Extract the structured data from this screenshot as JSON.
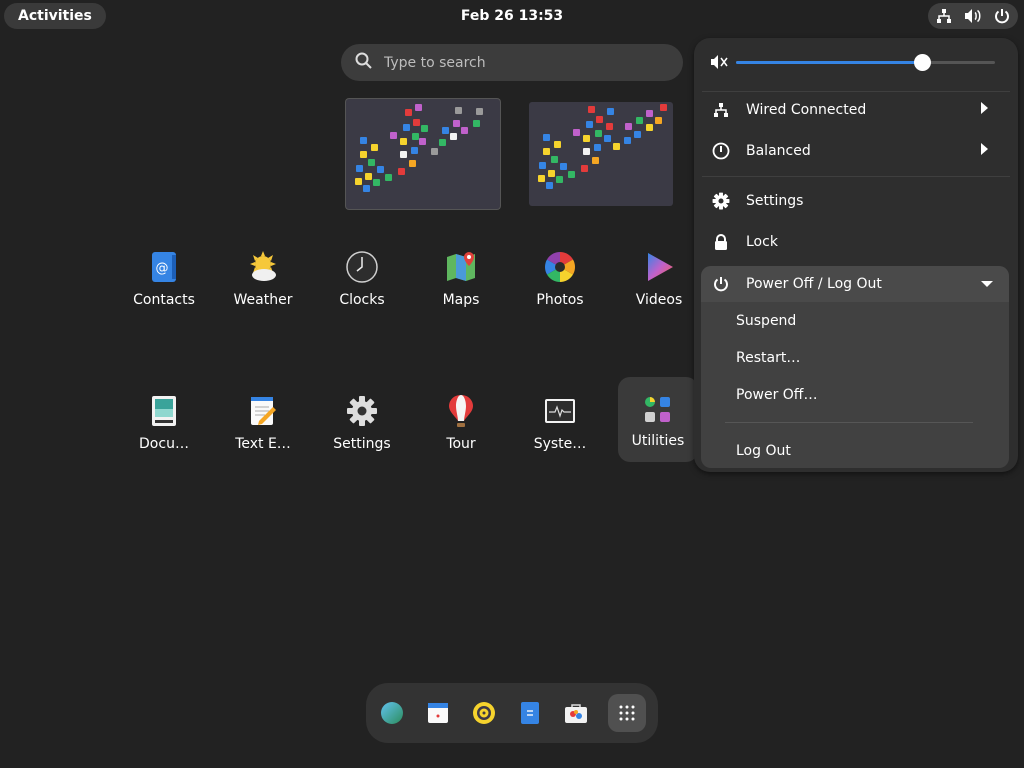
{
  "topbar": {
    "activities_label": "Activities",
    "clock": "Feb 26  13:53",
    "tray_icons": [
      "network-icon",
      "volume-icon",
      "power-icon"
    ]
  },
  "search": {
    "placeholder": "Type to search"
  },
  "apps": [
    {
      "name": "contacts",
      "label": "Contacts"
    },
    {
      "name": "weather",
      "label": "Weather"
    },
    {
      "name": "clocks",
      "label": "Clocks"
    },
    {
      "name": "maps",
      "label": "Maps"
    },
    {
      "name": "photos",
      "label": "Photos"
    },
    {
      "name": "videos",
      "label": "Videos"
    },
    {
      "name": "documents",
      "label": "Docu…"
    },
    {
      "name": "text-editor",
      "label": "Text E…"
    },
    {
      "name": "settings",
      "label": "Settings"
    },
    {
      "name": "tour",
      "label": "Tour"
    },
    {
      "name": "system-monitor",
      "label": "Syste…"
    },
    {
      "name": "utilities",
      "label": "Utilities"
    }
  ],
  "dock": [
    "web-browser-icon",
    "calendar-icon",
    "music-icon",
    "files-icon",
    "software-icon",
    "show-apps-icon"
  ],
  "quick_settings": {
    "volume_level": 0.72,
    "wired": "Wired Connected",
    "power_mode": "Balanced",
    "settings": "Settings",
    "lock": "Lock",
    "power_menu": {
      "title": "Power Off / Log Out",
      "suspend": "Suspend",
      "restart": "Restart…",
      "power_off": "Power Off…",
      "log_out": "Log Out"
    }
  },
  "colors": {
    "accent": "#3584e4",
    "background": "#222222",
    "panel": "#2e2e2e"
  }
}
